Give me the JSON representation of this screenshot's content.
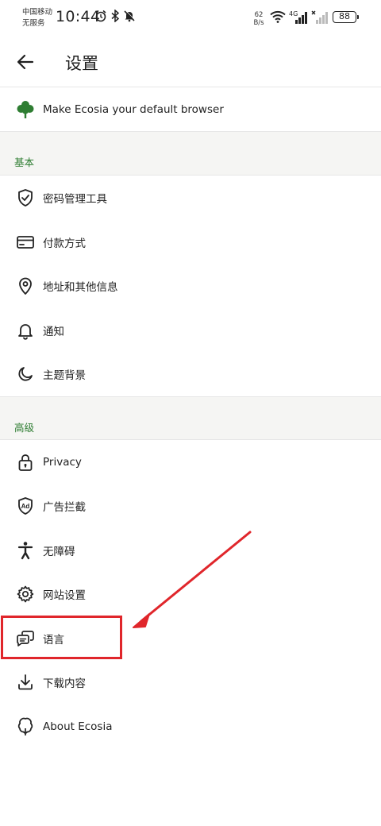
{
  "status_bar": {
    "carrier_line1": "中国移动",
    "carrier_line2": "无服务",
    "time": "10:44",
    "net_speed_value": "62",
    "net_speed_unit": "B/s",
    "signal_type": "4G",
    "battery": "88"
  },
  "header": {
    "title": "设置"
  },
  "default_browser": {
    "label": "Make Ecosia your default browser"
  },
  "sections": {
    "basic": {
      "title": "基本",
      "items": [
        {
          "label": "密码管理工具",
          "icon": "shield-check-icon"
        },
        {
          "label": "付款方式",
          "icon": "credit-card-icon"
        },
        {
          "label": "地址和其他信息",
          "icon": "location-pin-icon"
        },
        {
          "label": "通知",
          "icon": "bell-icon"
        },
        {
          "label": "主题背景",
          "icon": "moon-icon"
        }
      ]
    },
    "advanced": {
      "title": "高级",
      "items": [
        {
          "label": "Privacy",
          "icon": "lock-icon"
        },
        {
          "label": "广告拦截",
          "icon": "ad-block-icon"
        },
        {
          "label": "无障碍",
          "icon": "accessibility-icon"
        },
        {
          "label": "网站设置",
          "icon": "gear-icon"
        },
        {
          "label": "语言",
          "icon": "language-chat-icon"
        },
        {
          "label": "下载内容",
          "icon": "download-icon"
        },
        {
          "label": "About Ecosia",
          "icon": "ecosia-tree-outline-icon"
        }
      ]
    }
  },
  "colors": {
    "accent_green": "#2e7d32",
    "annotation_red": "#e0262b",
    "section_bg": "#f5f5f3"
  }
}
